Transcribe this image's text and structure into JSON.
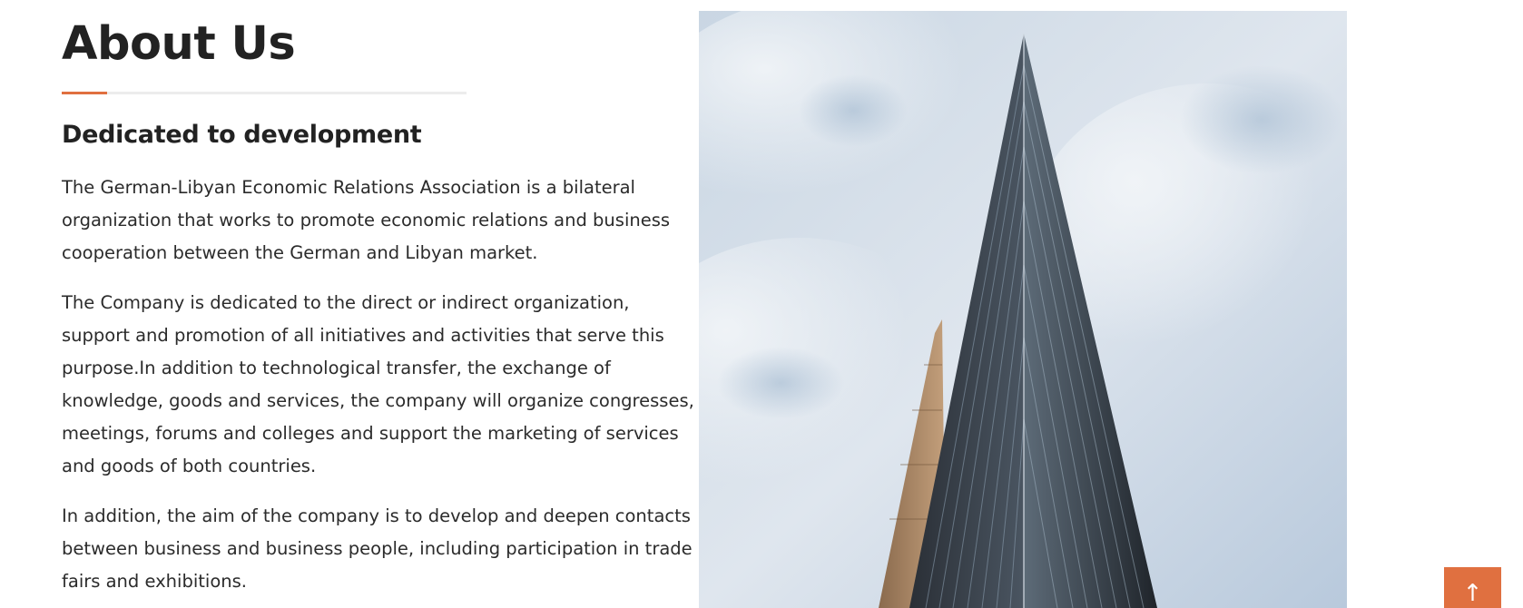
{
  "about": {
    "title": "About Us",
    "subtitle": "Dedicated to development",
    "paragraphs": [
      "The German-Libyan Economic Relations Association is a bilateral organization that works to promote economic relations and business cooperation between the German and Libyan market.",
      "The Company is dedicated to the direct or indirect organization, support and promotion of all initiatives and activities that serve this purpose.In addition to technological transfer, the exchange of knowledge, goods and services, the company will organize congresses, meetings, forums and colleges and support the marketing of services and goods of both countries.",
      "In addition, the aim of the company is to develop and deepen contacts between business and business people, including participation in trade fairs and exhibitions."
    ]
  },
  "image": {
    "subject": "glass skyscraper tower against cloudy sky"
  },
  "scroll_top": {
    "icon": "arrow-up-icon",
    "glyph": "↑"
  },
  "colors": {
    "accent": "#e07040",
    "text": "#2b2b2b",
    "heading": "#222222"
  }
}
